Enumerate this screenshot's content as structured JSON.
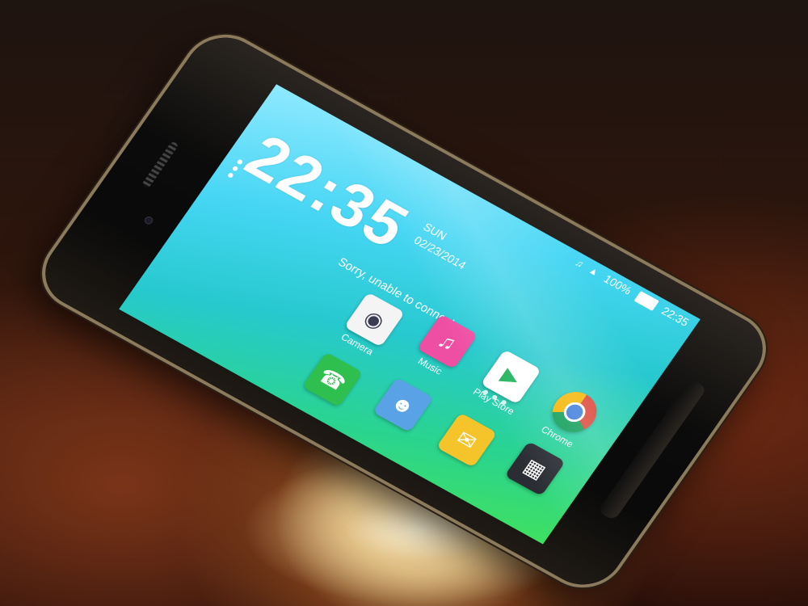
{
  "status_bar": {
    "battery": "100%",
    "time": "22:35"
  },
  "lockscreen": {
    "clock": "22:35",
    "day": "SUN",
    "date": "02/23/2014",
    "notice": "Sorry, unable to connect."
  },
  "apps": [
    {
      "label": "Chrome",
      "icon": "chrome-icon"
    },
    {
      "label": "Play Store",
      "icon": "play-store-icon"
    },
    {
      "label": "",
      "icon": "app-drawer-icon"
    },
    {
      "label": "Music",
      "icon": "music-icon"
    },
    {
      "label": "",
      "icon": "messaging-icon"
    },
    {
      "label": "Camera",
      "icon": "camera-icon"
    },
    {
      "label": "",
      "icon": "contacts-icon"
    },
    {
      "label": "",
      "icon": "phone-icon"
    }
  ]
}
